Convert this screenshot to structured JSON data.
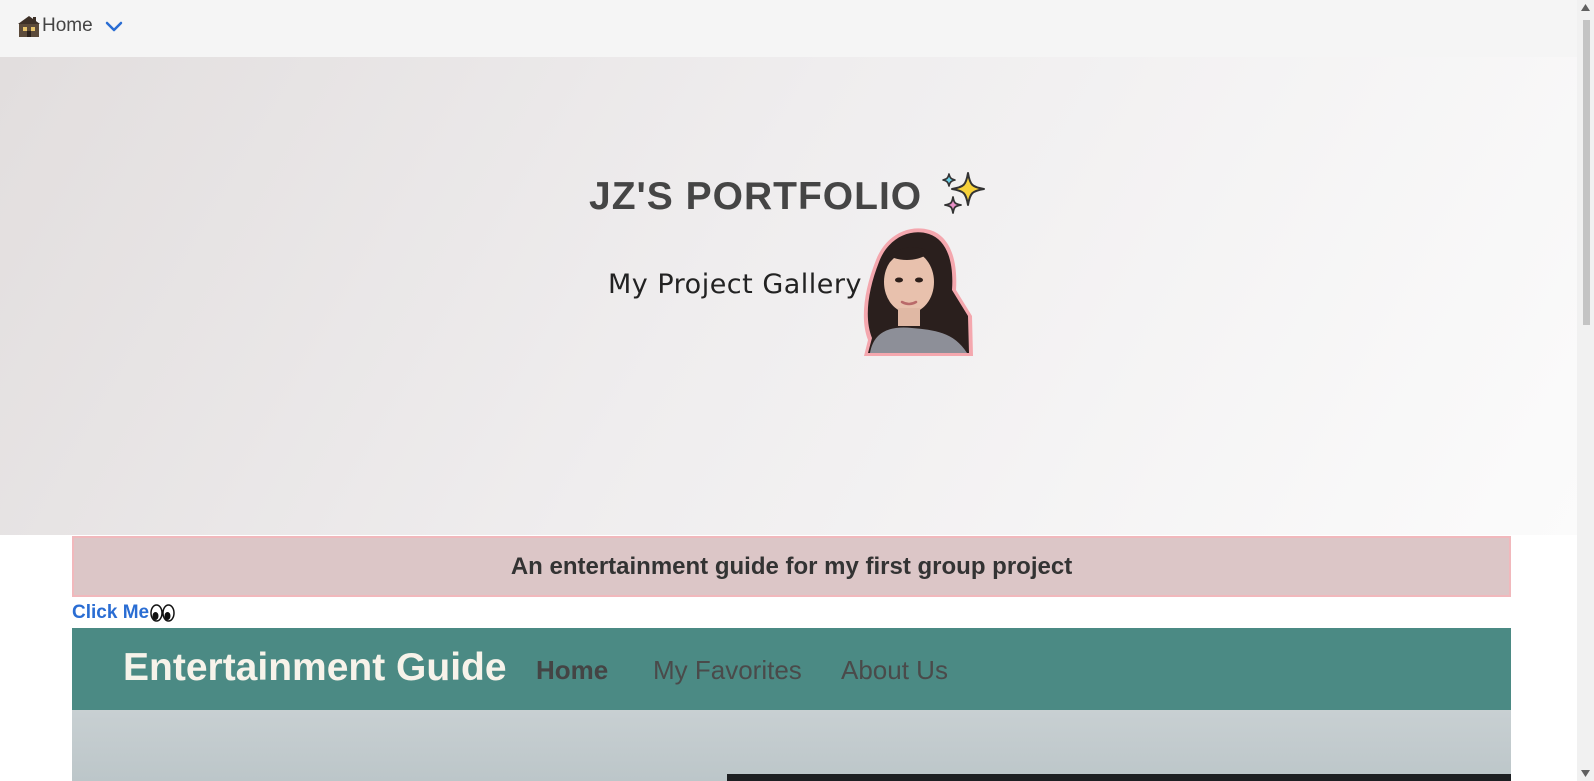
{
  "nav": {
    "home_label": "Home",
    "home_icon": "house-icon",
    "dropdown_icon": "chevron-down-icon"
  },
  "hero": {
    "title": "JZ'S PORTFOLIO",
    "title_icon": "sparkles-icon",
    "subtitle": "My Project Gallery",
    "avatar": "profile-photo"
  },
  "project": {
    "banner_text": "An entertainment guide for my first group project",
    "click_label": "Click Me",
    "click_icon": "eyes-icon"
  },
  "preview": {
    "brand": "Entertainment Guide",
    "links": [
      "Home",
      "My Favorites",
      "About Us"
    ]
  },
  "colors": {
    "accent_link": "#2a6dd3",
    "banner_bg": "#dcc6c7",
    "banner_border": "#f1b8bc",
    "preview_nav_bg": "#4b8a84"
  }
}
